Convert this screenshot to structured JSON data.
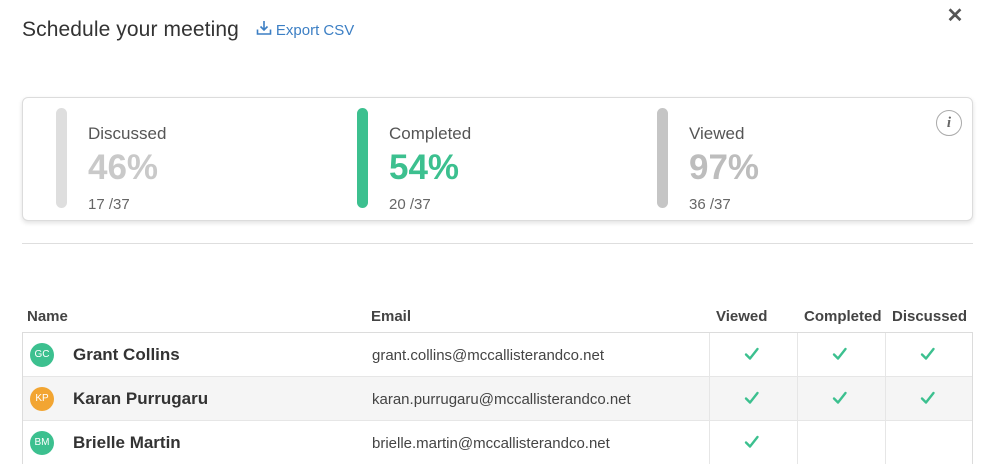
{
  "header": {
    "title": "Schedule your meeting",
    "export_label": "Export CSV"
  },
  "close_icon": "close-icon",
  "stats": [
    {
      "label": "Discussed",
      "percent": "46%",
      "count": "17 /37",
      "color": "#dedede",
      "text_color": "#c9c9c9"
    },
    {
      "label": "Completed",
      "percent": "54%",
      "count": "20 /37",
      "color": "#3cc08f",
      "text_color": "#3cc08f"
    },
    {
      "label": "Viewed",
      "percent": "97%",
      "count": "36 /37",
      "color": "#c5c5c5",
      "text_color": "#bdbdbd"
    }
  ],
  "info_glyph": "i",
  "table": {
    "columns": {
      "name": "Name",
      "email": "Email",
      "viewed": "Viewed",
      "completed": "Completed",
      "discussed": "Discussed"
    },
    "rows": [
      {
        "initials": "GC",
        "avatar_color": "#3cc08f",
        "name": "Grant Collins",
        "email": "grant.collins@mccallisterandco.net",
        "viewed": true,
        "completed": true,
        "discussed": true
      },
      {
        "initials": "KP",
        "avatar_color": "#f2a532",
        "name": "Karan Purrugaru",
        "email": "karan.purrugaru@mccallisterandco.net",
        "viewed": true,
        "completed": true,
        "discussed": true
      },
      {
        "initials": "BM",
        "avatar_color": "#3cc08f",
        "name": "Brielle Martin",
        "email": "brielle.martin@mccallisterandco.net",
        "viewed": true,
        "completed": false,
        "discussed": false
      }
    ]
  },
  "check_color": "#3cc08f"
}
